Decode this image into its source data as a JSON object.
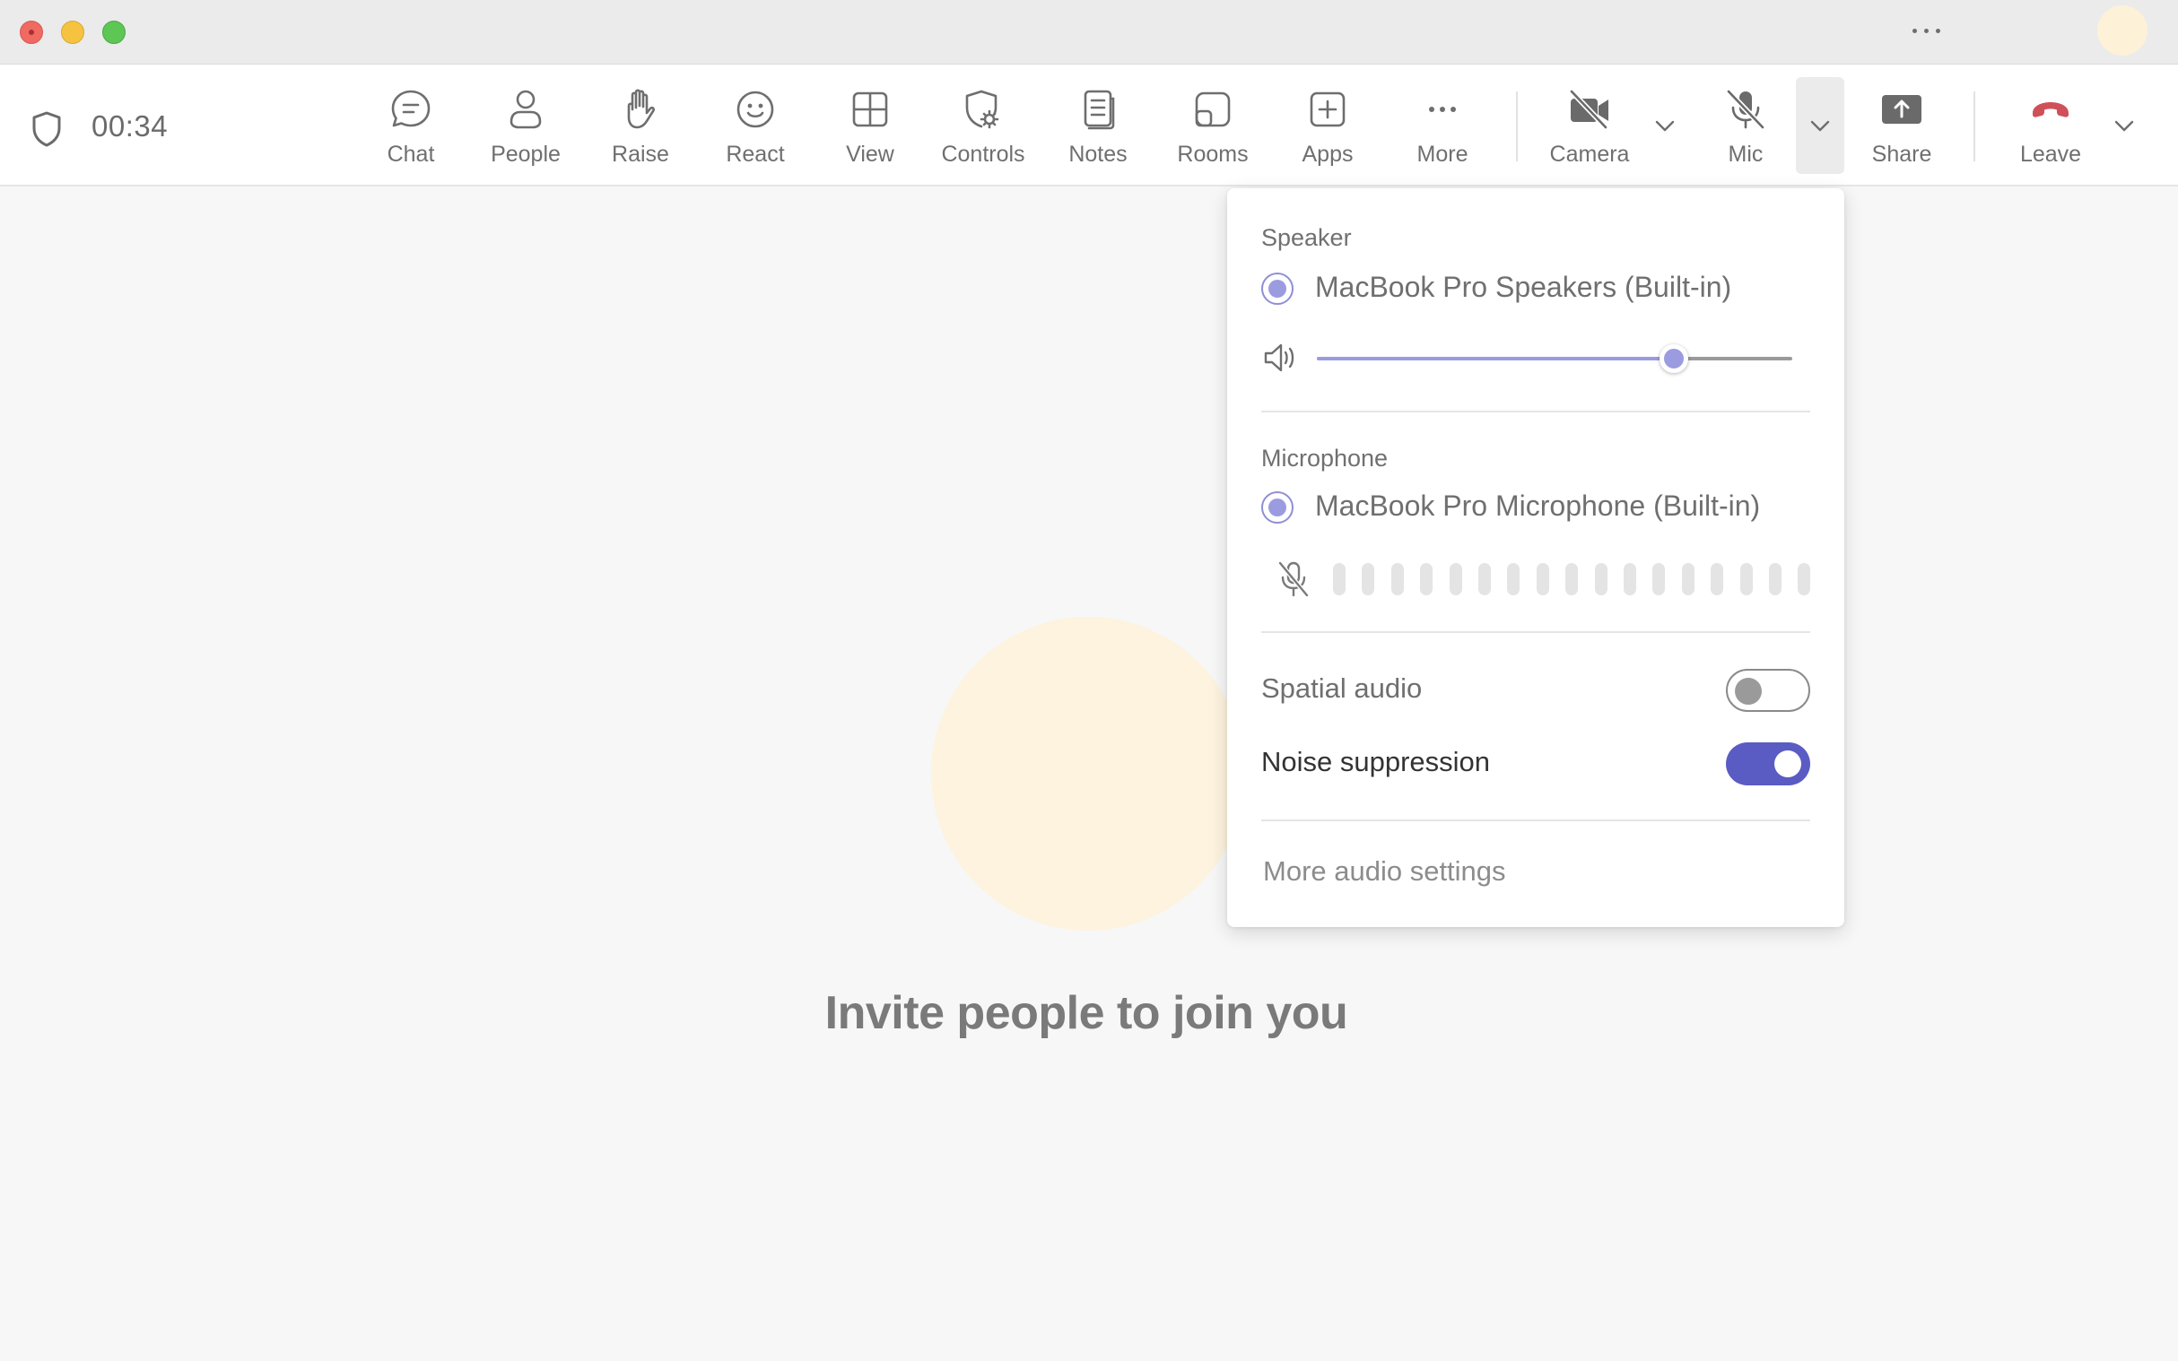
{
  "titlebar": {
    "window_controls": [
      "close",
      "minimize",
      "zoom"
    ],
    "more_icon": "more-horizontal-icon"
  },
  "toolbar": {
    "timer": "00:34",
    "buttons": [
      {
        "label": "Chat",
        "icon": "chat-icon"
      },
      {
        "label": "People",
        "icon": "people-icon"
      },
      {
        "label": "Raise",
        "icon": "raise-hand-icon"
      },
      {
        "label": "React",
        "icon": "smiley-icon"
      },
      {
        "label": "View",
        "icon": "grid-view-icon"
      },
      {
        "label": "Controls",
        "icon": "shield-gear-icon"
      },
      {
        "label": "Notes",
        "icon": "notes-icon"
      },
      {
        "label": "Rooms",
        "icon": "rooms-icon"
      },
      {
        "label": "Apps",
        "icon": "add-app-icon"
      },
      {
        "label": "More",
        "icon": "more-horizontal-icon"
      }
    ],
    "camera": {
      "label": "Camera",
      "icon": "camera-off-icon"
    },
    "mic": {
      "label": "Mic",
      "icon": "mic-off-icon"
    },
    "share": {
      "label": "Share",
      "icon": "share-screen-icon"
    },
    "leave": {
      "label": "Leave",
      "icon": "hang-up-icon",
      "color": "#d0505a"
    }
  },
  "stage": {
    "invite_text": "Invite people to join you"
  },
  "audio_panel": {
    "speaker_title": "Speaker",
    "speaker_device": "MacBook Pro Speakers (Built-in)",
    "speaker_volume": 0.75,
    "microphone_title": "Microphone",
    "microphone_device": "MacBook Pro Microphone (Built-in)",
    "mic_level_bars": 17,
    "spatial_audio_label": "Spatial audio",
    "spatial_audio_on": false,
    "noise_suppression_label": "Noise suppression",
    "noise_suppression_on": true,
    "more_settings": "More audio settings"
  },
  "colors": {
    "accent": "#5b5bc4",
    "radio": "#9b9be0",
    "avatar": "#fdf3de",
    "leave": "#d0505a"
  }
}
